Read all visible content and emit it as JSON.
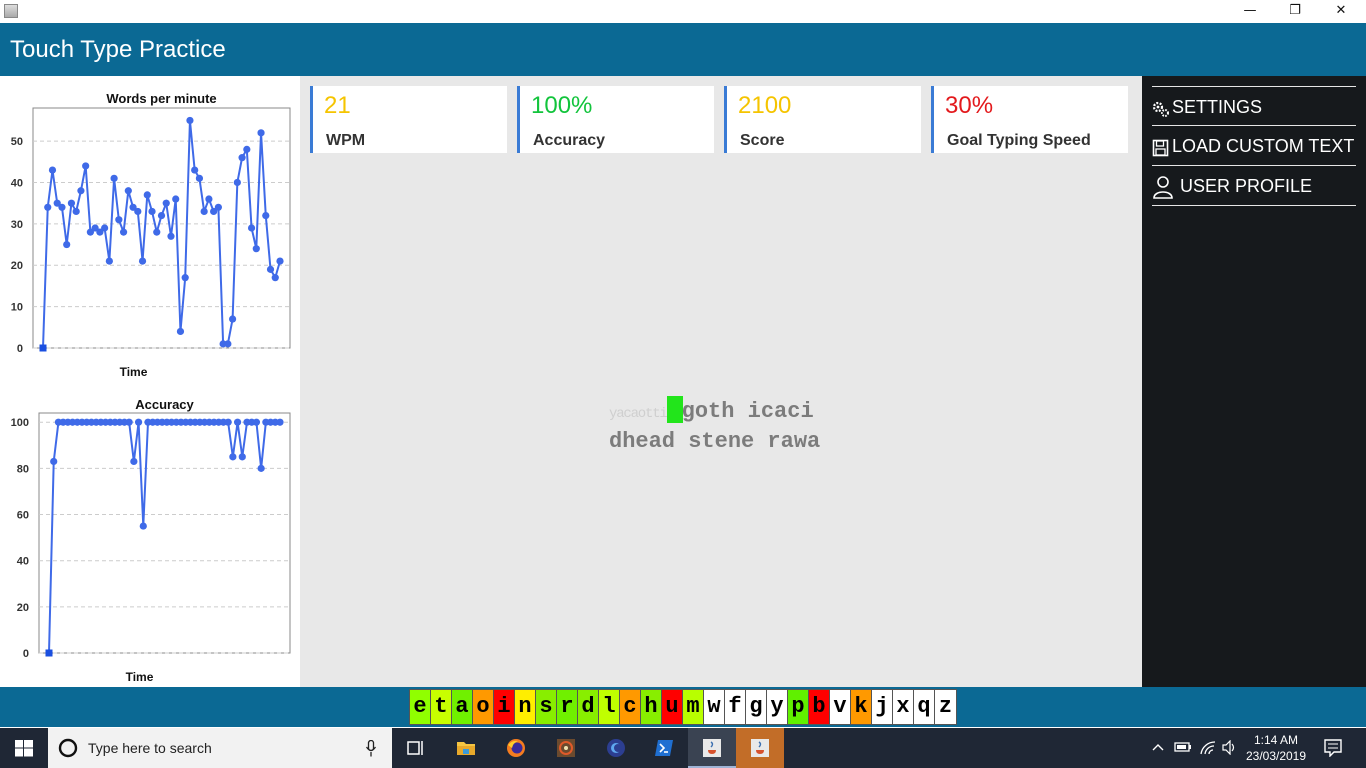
{
  "window": {
    "minimize": "—",
    "restore": "❐",
    "close": "✕"
  },
  "app": {
    "title": "Touch Type Practice"
  },
  "stats": [
    {
      "value": "21",
      "label": "WPM",
      "color": "#f5c400"
    },
    {
      "value": "100%",
      "label": "Accuracy",
      "color": "#12c43c"
    },
    {
      "value": "2100",
      "label": "Score",
      "color": "#f5c400"
    },
    {
      "value": "30%",
      "label": "Goal Typing Speed",
      "color": "#e3191c"
    }
  ],
  "typing": {
    "typed": "yacaotti",
    "line1_rest": "goth icaci",
    "line2": "dhead stene rawa"
  },
  "menu": [
    {
      "label": "SETTINGS",
      "icon": "gears-icon"
    },
    {
      "label": "LOAD CUSTOM TEXT",
      "icon": "save-icon"
    },
    {
      "label": "USER PROFILE",
      "icon": "user-icon"
    }
  ],
  "keys": [
    {
      "ch": "e",
      "color": "#90ff00"
    },
    {
      "ch": "t",
      "color": "#c8ff00"
    },
    {
      "ch": "a",
      "color": "#70f000"
    },
    {
      "ch": "o",
      "color": "#ff9900"
    },
    {
      "ch": "i",
      "color": "#ff0000"
    },
    {
      "ch": "n",
      "color": "#ffee00"
    },
    {
      "ch": "s",
      "color": "#88ee00"
    },
    {
      "ch": "r",
      "color": "#70f000"
    },
    {
      "ch": "d",
      "color": "#88ee00"
    },
    {
      "ch": "l",
      "color": "#c0ff00"
    },
    {
      "ch": "c",
      "color": "#ff9900"
    },
    {
      "ch": "h",
      "color": "#88ee00"
    },
    {
      "ch": "u",
      "color": "#ff0000"
    },
    {
      "ch": "m",
      "color": "#b8ff00"
    },
    {
      "ch": "w",
      "color": "#ffffff"
    },
    {
      "ch": "f",
      "color": "#ffffff"
    },
    {
      "ch": "g",
      "color": "#ffffff"
    },
    {
      "ch": "y",
      "color": "#ffffff"
    },
    {
      "ch": "p",
      "color": "#60f000"
    },
    {
      "ch": "b",
      "color": "#ff0000"
    },
    {
      "ch": "v",
      "color": "#ffffff"
    },
    {
      "ch": "k",
      "color": "#ff9900"
    },
    {
      "ch": "j",
      "color": "#ffffff"
    },
    {
      "ch": "x",
      "color": "#ffffff"
    },
    {
      "ch": "q",
      "color": "#ffffff"
    },
    {
      "ch": "z",
      "color": "#ffffff"
    }
  ],
  "taskbar": {
    "search_placeholder": "Type here to search",
    "time": "1:14 AM",
    "date": "23/03/2019"
  },
  "chart_data": [
    {
      "type": "line",
      "title": "Words per minute",
      "xlabel": "Time",
      "ylabel": "",
      "ylim": [
        0,
        58
      ],
      "yticks": [
        0,
        10,
        20,
        30,
        40,
        50
      ],
      "grid": true,
      "values": [
        0,
        34,
        43,
        35,
        34,
        25,
        35,
        33,
        38,
        44,
        28,
        29,
        28,
        29,
        21,
        41,
        31,
        28,
        38,
        34,
        33,
        21,
        37,
        33,
        28,
        32,
        35,
        27,
        36,
        4,
        17,
        55,
        43,
        41,
        33,
        36,
        33,
        34,
        1,
        1,
        7,
        40,
        46,
        48,
        29,
        24,
        52,
        32,
        19,
        17,
        21
      ]
    },
    {
      "type": "line",
      "title": "Accuracy",
      "xlabel": "Time",
      "ylabel": "",
      "ylim": [
        0,
        104
      ],
      "yticks": [
        0,
        20,
        40,
        60,
        80,
        100
      ],
      "grid": true,
      "values": [
        0,
        83,
        100,
        100,
        100,
        100,
        100,
        100,
        100,
        100,
        100,
        100,
        100,
        100,
        100,
        100,
        100,
        100,
        83,
        100,
        55,
        100,
        100,
        100,
        100,
        100,
        100,
        100,
        100,
        100,
        100,
        100,
        100,
        100,
        100,
        100,
        100,
        100,
        100,
        85,
        100,
        85,
        100,
        100,
        100,
        80,
        100,
        100,
        100,
        100
      ]
    }
  ]
}
